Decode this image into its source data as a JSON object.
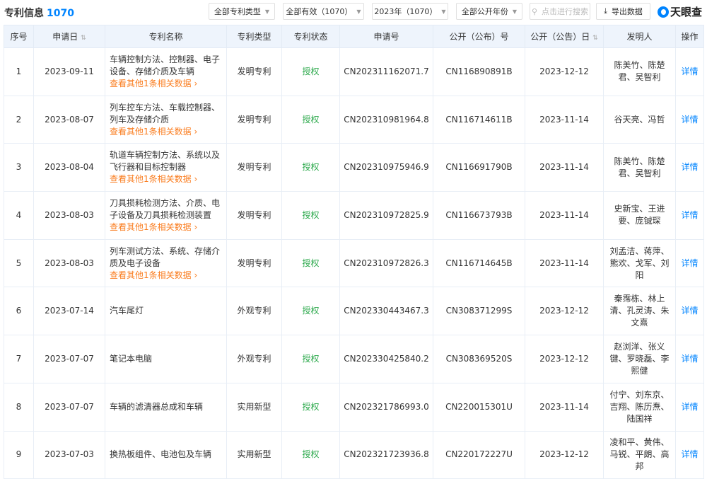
{
  "header": {
    "title": "专利信息",
    "count": "1070",
    "filters": [
      "全部专利类型",
      "全部有效（1070）",
      "2023年（1070）",
      "全部公开年份"
    ],
    "search_placeholder": "点击进行搜索",
    "export_label": "导出数据",
    "logo_text": "天眼查"
  },
  "columns": [
    "序号",
    "申请日",
    "专利名称",
    "专利类型",
    "专利状态",
    "申请号",
    "公开（公布）号",
    "公开（公告）日",
    "发明人",
    "操作"
  ],
  "more_label": "查看其他1条相关数据",
  "detail_label": "详情",
  "rows": [
    {
      "no": "1",
      "date": "2023-09-11",
      "name": "车辆控制方法、控制器、电子设备、存储介质及车辆",
      "more": true,
      "type": "发明专利",
      "status": "授权",
      "app_no": "CN202311162071.7",
      "pub_no": "CN116890891B",
      "pub_date": "2023-12-12",
      "inventors": "陈美竹、陈楚君、吴智利"
    },
    {
      "no": "2",
      "date": "2023-08-07",
      "name": "列车控车方法、车载控制器、列车及存储介质",
      "more": true,
      "type": "发明专利",
      "status": "授权",
      "app_no": "CN202310981964.8",
      "pub_no": "CN116714611B",
      "pub_date": "2023-11-14",
      "inventors": "谷天亮、冯哲"
    },
    {
      "no": "3",
      "date": "2023-08-04",
      "name": "轨道车辆控制方法、系统以及飞行器和目标控制器",
      "more": true,
      "type": "发明专利",
      "status": "授权",
      "app_no": "CN202310975946.9",
      "pub_no": "CN116691790B",
      "pub_date": "2023-11-14",
      "inventors": "陈美竹、陈楚君、吴智利"
    },
    {
      "no": "4",
      "date": "2023-08-03",
      "name": "刀具损耗检测方法、介质、电子设备及刀具损耗检测装置",
      "more": true,
      "type": "发明专利",
      "status": "授权",
      "app_no": "CN202310972825.9",
      "pub_no": "CN116673793B",
      "pub_date": "2023-11-14",
      "inventors": "史新宝、王进要、庞铖琛"
    },
    {
      "no": "5",
      "date": "2023-08-03",
      "name": "列车测试方法、系统、存储介质及电子设备",
      "more": true,
      "type": "发明专利",
      "status": "授权",
      "app_no": "CN202310972826.3",
      "pub_no": "CN116714645B",
      "pub_date": "2023-11-14",
      "inventors": "刘孟洁、蒋萍、熊欢、戈军、刘阳"
    },
    {
      "no": "6",
      "date": "2023-07-14",
      "name": "汽车尾灯",
      "more": false,
      "type": "外观专利",
      "status": "授权",
      "app_no": "CN202330443467.3",
      "pub_no": "CN308371299S",
      "pub_date": "2023-12-12",
      "inventors": "秦霈栋、林上清、孔灵涛、朱文熹"
    },
    {
      "no": "7",
      "date": "2023-07-07",
      "name": "笔记本电脑",
      "more": false,
      "type": "外观专利",
      "status": "授权",
      "app_no": "CN202330425840.2",
      "pub_no": "CN308369520S",
      "pub_date": "2023-12-12",
      "inventors": "赵浏洋、张义键、罗晓磊、李熙健"
    },
    {
      "no": "8",
      "date": "2023-07-07",
      "name": "车辆的滤清器总成和车辆",
      "more": false,
      "type": "实用新型",
      "status": "授权",
      "app_no": "CN202321786993.0",
      "pub_no": "CN220015301U",
      "pub_date": "2023-11-14",
      "inventors": "付宁、刘东京、吉翔、陈历焘、陆国祥"
    },
    {
      "no": "9",
      "date": "2023-07-03",
      "name": "换热板组件、电池包及车辆",
      "more": false,
      "type": "实用新型",
      "status": "授权",
      "app_no": "CN202321723936.8",
      "pub_no": "CN220172227U",
      "pub_date": "2023-12-12",
      "inventors": "凌和平、黄伟、马锐、平朗、高邦"
    }
  ]
}
